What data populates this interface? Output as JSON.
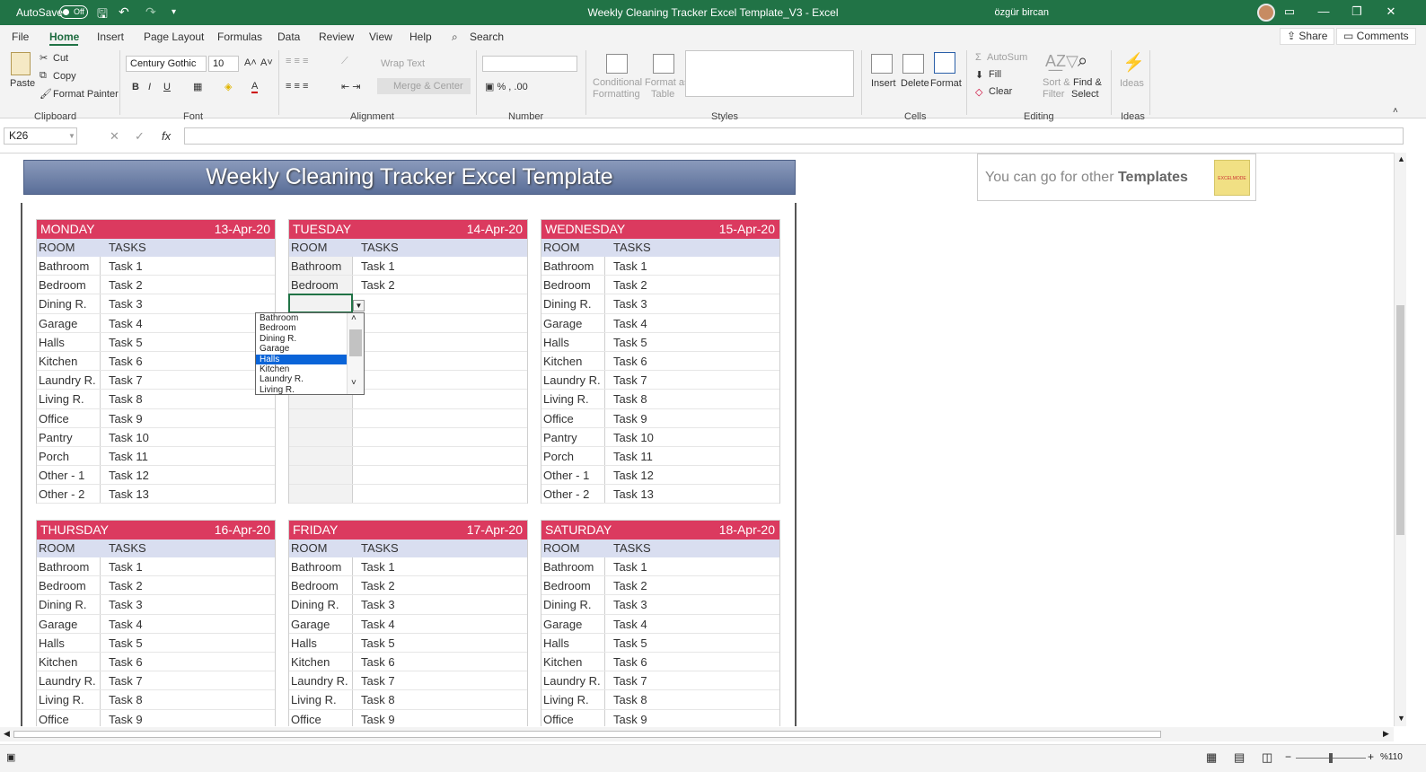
{
  "titlebar": {
    "autosave_label": "AutoSave",
    "autosave_state": "Off",
    "title": "Weekly Cleaning Tracker Excel Template_V3  -  Excel",
    "user": "özgür bircan"
  },
  "menu": {
    "tabs": [
      "File",
      "Home",
      "Insert",
      "Page Layout",
      "Formulas",
      "Data",
      "Review",
      "View",
      "Help"
    ],
    "search": "Search",
    "share": "Share",
    "comments": "Comments"
  },
  "ribbon": {
    "paste": "Paste",
    "cut": "Cut",
    "copy": "Copy",
    "format_painter": "Format Painter",
    "clipboard": "Clipboard",
    "font_name": "Century Gothic",
    "font_size": "10",
    "font": "Font",
    "wrap_text": "Wrap Text",
    "merge_center": "Merge & Center",
    "alignment": "Alignment",
    "number": "Number",
    "conditional": "Conditional",
    "formatting": "Formatting",
    "format_as": "Format as",
    "table": "Table",
    "styles": "Styles",
    "insert": "Insert",
    "delete": "Delete",
    "format": "Format",
    "cells": "Cells",
    "autosum": "AutoSum",
    "fill": "Fill",
    "clear": "Clear",
    "sort_filter_1": "Sort &",
    "sort_filter_2": "Filter",
    "find_select_1": "Find &",
    "find_select_2": "Select",
    "editing": "Editing",
    "ideas": "Ideas"
  },
  "formula_bar": {
    "name_box": "K26",
    "formula": ""
  },
  "sheet": {
    "banner": "Weekly Cleaning Tracker Excel Template",
    "promo_text": "You can go for other ",
    "promo_bold": "Templates",
    "promo_logo": "EXCELMODE",
    "room_header": "ROOM",
    "tasks_header": "TASKS",
    "days": [
      {
        "name": "MONDAY",
        "date": "13-Apr-20"
      },
      {
        "name": "TUESDAY",
        "date": "14-Apr-20"
      },
      {
        "name": "WEDNESDAY",
        "date": "15-Apr-20"
      },
      {
        "name": "THURSDAY",
        "date": "16-Apr-20"
      },
      {
        "name": "FRIDAY",
        "date": "17-Apr-20"
      },
      {
        "name": "SATURDAY",
        "date": "18-Apr-20"
      }
    ],
    "rooms": [
      "Bathroom",
      "Bedroom",
      "Dining R.",
      "Garage",
      "Halls",
      "Kitchen",
      "Laundry R.",
      "Living R.",
      "Office",
      "Pantry",
      "Porch",
      "Other - 1",
      "Other - 2"
    ],
    "tasks": [
      "Task 1",
      "Task 2",
      "Task 3",
      "Task 4",
      "Task 5",
      "Task 6",
      "Task 7",
      "Task 8",
      "Task 9",
      "Task 10",
      "Task 11",
      "Task 12",
      "Task 13"
    ]
  },
  "dropdown": {
    "options": [
      "Bathroom",
      "Bedroom",
      "Dining R.",
      "Garage",
      "Halls",
      "Kitchen",
      "Laundry R.",
      "Living R."
    ],
    "selected_index": 4
  },
  "status": {
    "zoom": "%110"
  },
  "colors": {
    "accent": "#217346",
    "day_header": "#db3a5f",
    "col_header": "#d9def0"
  }
}
